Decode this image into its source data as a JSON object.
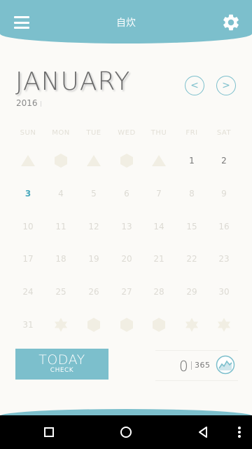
{
  "header": {
    "title": "自炊"
  },
  "calendar": {
    "month": "JANUARY",
    "year": "2016",
    "weekdays": [
      "SUN",
      "MON",
      "TUE",
      "WED",
      "THU",
      "FRI",
      "SAT"
    ],
    "weeks": [
      [
        {
          "t": "tri"
        },
        {
          "t": "hex"
        },
        {
          "t": "tri"
        },
        {
          "t": "hex"
        },
        {
          "t": "tri"
        },
        {
          "d": "1",
          "c": 1
        },
        {
          "d": "2",
          "c": 1
        }
      ],
      [
        {
          "d": "3",
          "today": 1
        },
        {
          "d": "4"
        },
        {
          "d": "5"
        },
        {
          "d": "6"
        },
        {
          "d": "7"
        },
        {
          "d": "8"
        },
        {
          "d": "9"
        }
      ],
      [
        {
          "d": "10"
        },
        {
          "d": "11"
        },
        {
          "d": "12"
        },
        {
          "d": "13"
        },
        {
          "d": "14"
        },
        {
          "d": "15"
        },
        {
          "d": "16"
        }
      ],
      [
        {
          "d": "17"
        },
        {
          "d": "18"
        },
        {
          "d": "19"
        },
        {
          "d": "20"
        },
        {
          "d": "21"
        },
        {
          "d": "22"
        },
        {
          "d": "23"
        }
      ],
      [
        {
          "d": "24"
        },
        {
          "d": "25"
        },
        {
          "d": "26"
        },
        {
          "d": "27"
        },
        {
          "d": "28"
        },
        {
          "d": "29"
        },
        {
          "d": "30"
        }
      ],
      [
        {
          "d": "31"
        },
        {
          "t": "star"
        },
        {
          "t": "hex"
        },
        {
          "t": "hex"
        },
        {
          "t": "hex"
        },
        {
          "t": "star"
        },
        {
          "t": "star"
        }
      ]
    ]
  },
  "today_button": {
    "label": "TODAY",
    "sub": "CHECK"
  },
  "counter": {
    "value": "0",
    "total": "365"
  },
  "colors": {
    "accent": "#7cbfcc",
    "today": "#4aa9bd",
    "shape": "#f1eee3"
  },
  "icons": {
    "menu": "hamburger-menu-icon",
    "settings": "gear-icon",
    "prev": "chevron-left-icon",
    "next": "chevron-right-icon",
    "stats": "line-chart-icon",
    "nav": [
      "square-recents-icon",
      "circle-home-icon",
      "triangle-back-icon",
      "vertical-dots-icon"
    ]
  }
}
